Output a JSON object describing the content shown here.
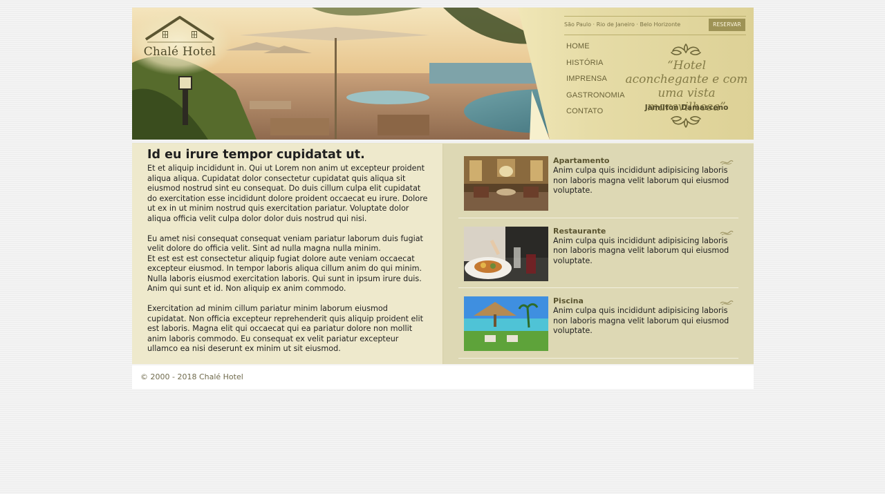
{
  "brand": {
    "name": "Chalé Hotel"
  },
  "header": {
    "cities": "São Paulo · Rio de Janeiro · Belo Horizonte",
    "reserve_label": "RESERVAR",
    "nav": [
      "HOME",
      "HISTÓRIA",
      "IMPRENSA",
      "GASTRONOMIA",
      "CONTATO"
    ],
    "quote": "“Hotel aconchegante e com uma vista maravilhosa”",
    "quote_author": "Jamilton Damasceno"
  },
  "article": {
    "title": "Id eu irure tempor cupidatat ut.",
    "paragraphs": [
      "Et et aliquip incididunt in. Qui ut Lorem non anim ut excepteur proident aliqua aliqua. Cupidatat dolor consectetur cupidatat quis aliqua sit eiusmod nostrud sint eu consequat. Do duis cillum culpa elit cupidatat do exercitation esse incididunt dolore proident occaecat eu irure. Dolore ut ex in ut minim nostrud quis exercitation pariatur. Voluptate dolor aliqua officia velit culpa dolor dolor duis nostrud qui nisi.",
      "Eu amet nisi consequat consequat veniam pariatur laborum duis fugiat velit dolore do officia velit. Sint ad nulla magna nulla minim.",
      "Et est est est consectetur aliquip fugiat dolore aute veniam occaecat excepteur eiusmod. In tempor laboris aliqua cillum anim do qui minim. Nulla laboris eiusmod exercitation laboris. Qui sunt in ipsum irure duis. Anim qui sunt et id. Non aliquip ex anim commodo.",
      "Exercitation ad minim cillum pariatur minim laborum eiusmod cupidatat. Non officia excepteur reprehenderit quis aliquip proident elit est laboris. Magna elit qui occaecat qui ea pariatur dolore non mollit anim laboris commodo. Eu consequat ex velit pariatur excepteur ullamco ea nisi deserunt ex minim ut sit eiusmod."
    ]
  },
  "features": [
    {
      "title": "Apartamento",
      "text": "Anim culpa quis incididunt adipisicing laboris non laboris magna velit laborum qui eiusmod voluptate."
    },
    {
      "title": "Restaurante",
      "text": "Anim culpa quis incididunt adipisicing laboris non laboris magna velit laborum qui eiusmod voluptate."
    },
    {
      "title": "Piscina",
      "text": "Anim culpa quis incididunt adipisicing laboris non laboris magna velit laborum qui eiusmod voluptate."
    }
  ],
  "footer": {
    "copyright": "© 2000 - 2018 Chalé Hotel"
  },
  "colors": {
    "header_panel": "#e2d9a6",
    "reserve_button": "#9e9356",
    "left_column": "#eee9cc",
    "right_column": "#ddd8b4",
    "text_dark": "#222222",
    "title_olive": "#5a5430"
  }
}
